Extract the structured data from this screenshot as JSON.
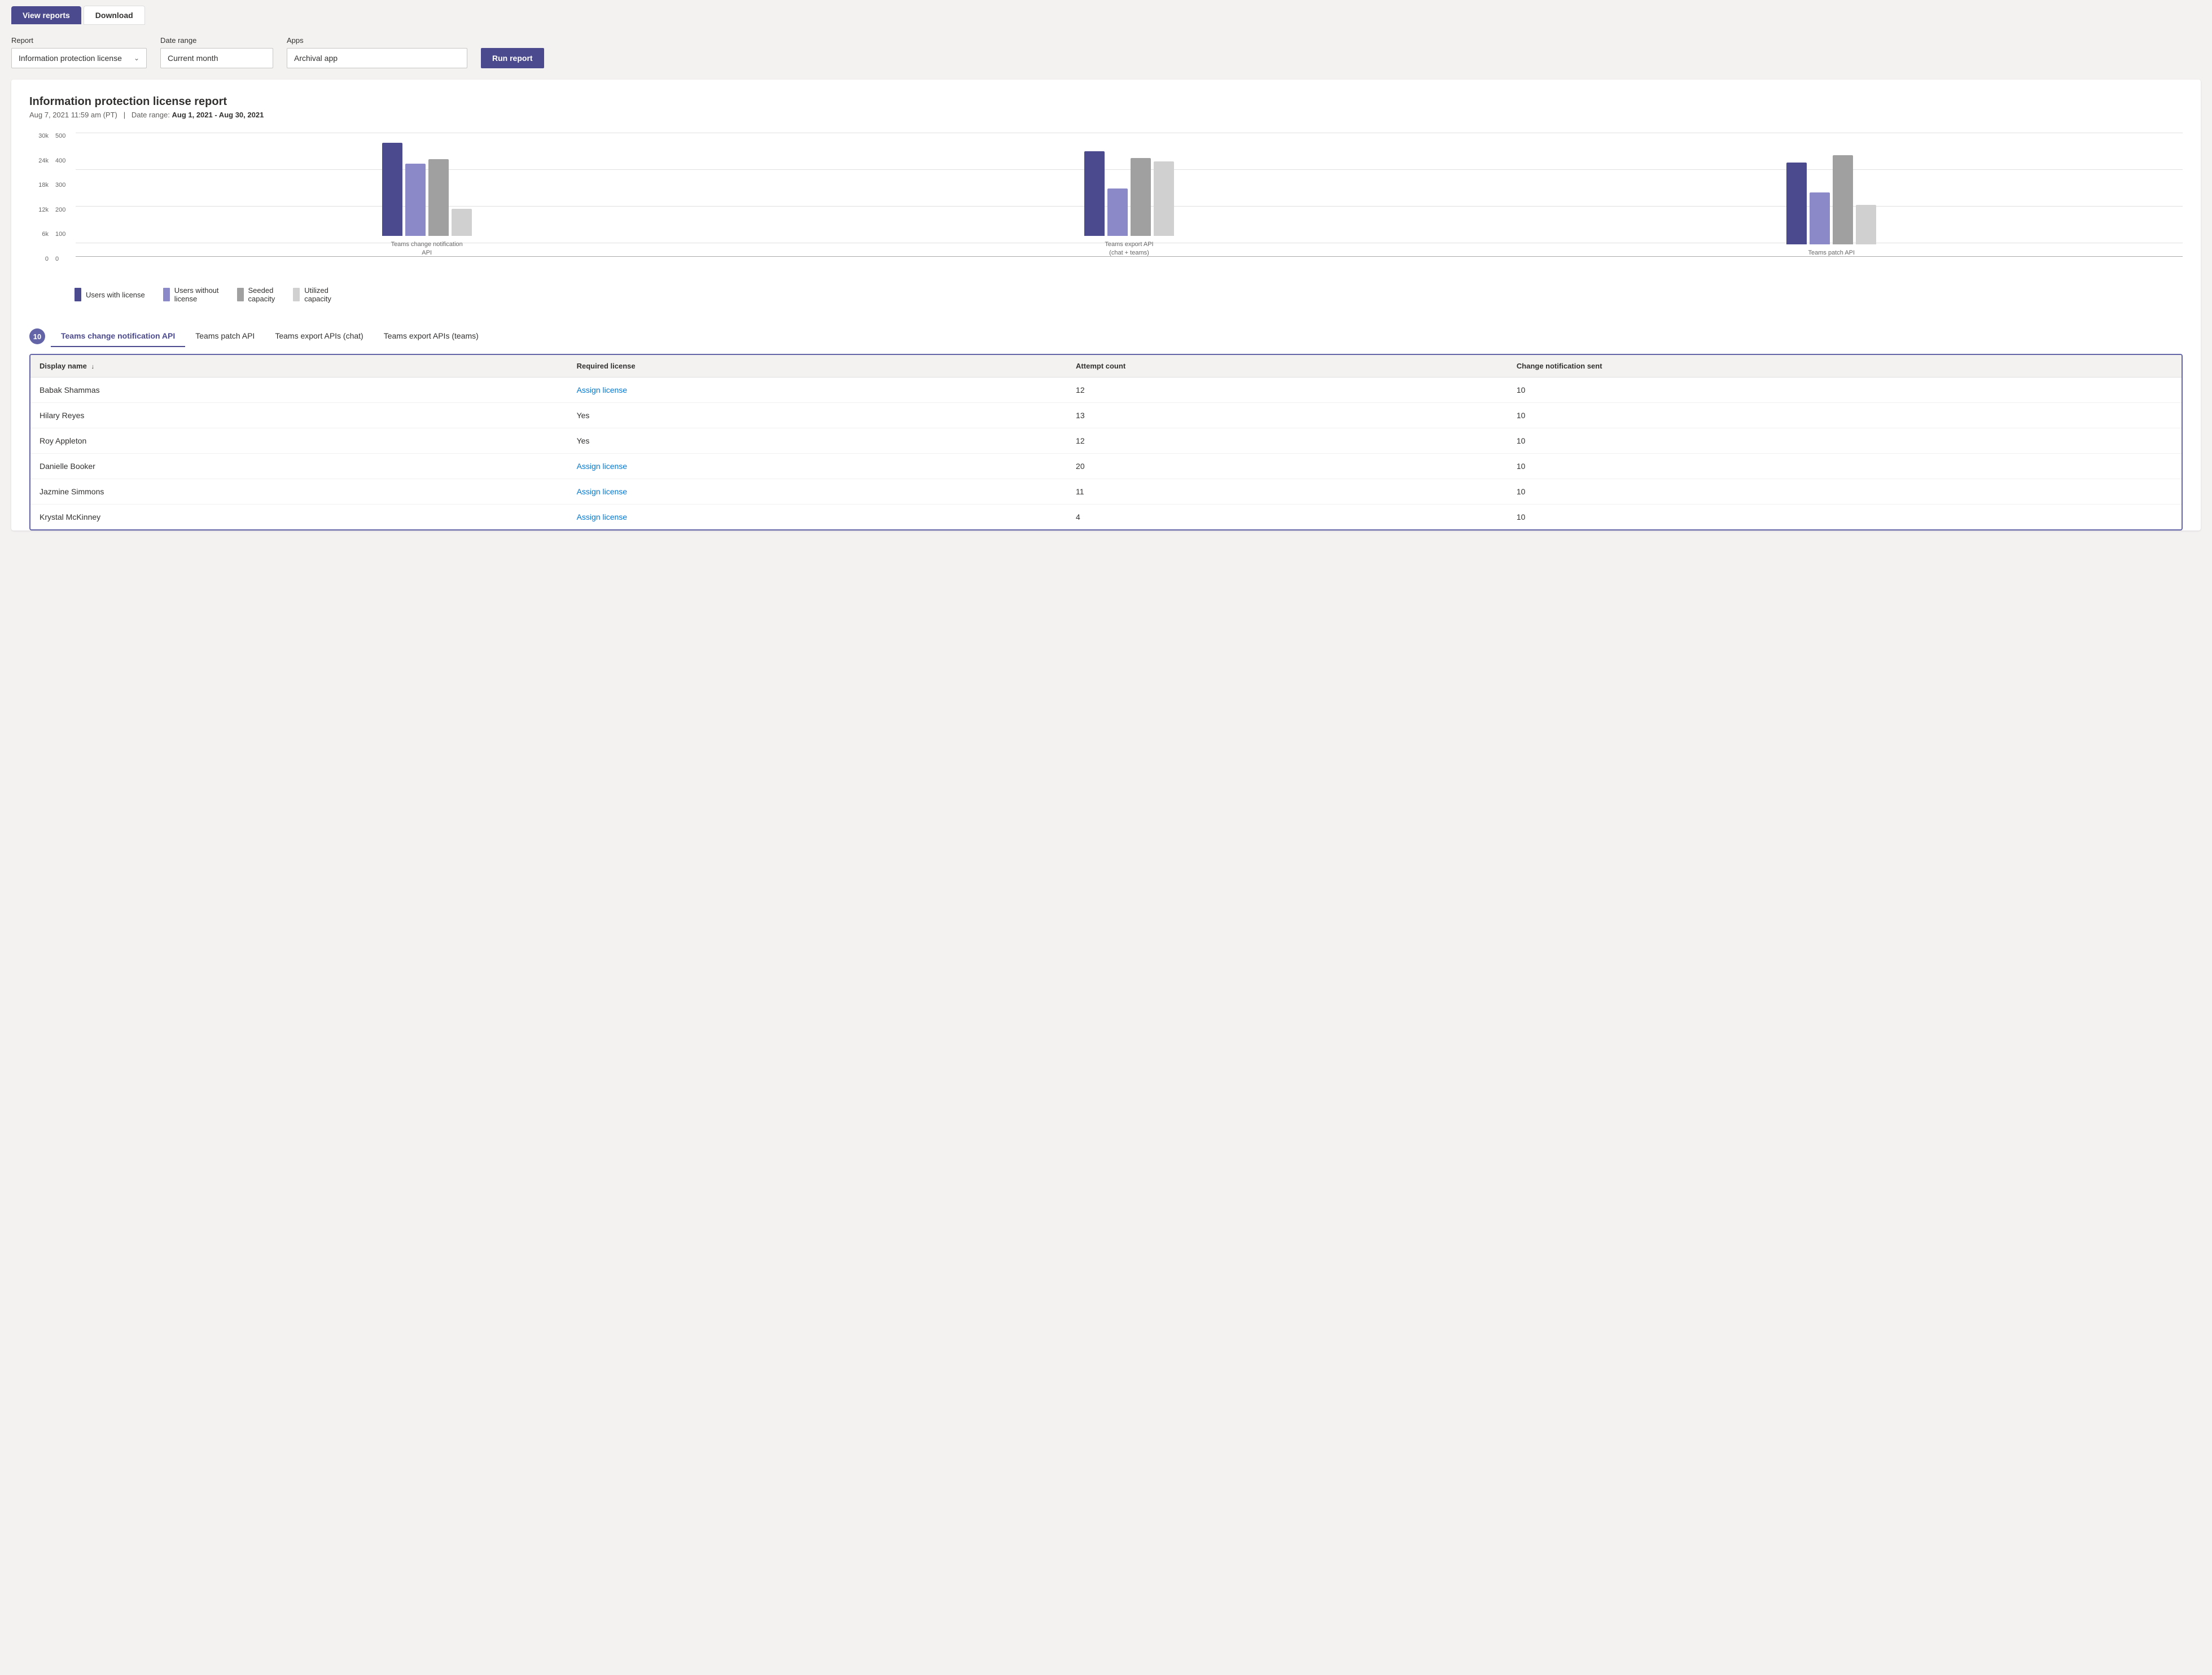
{
  "tabs": [
    {
      "id": "view-reports",
      "label": "View reports",
      "active": true
    },
    {
      "id": "download",
      "label": "Download",
      "active": false
    }
  ],
  "filters": {
    "report_label": "Report",
    "report_value": "Information protection license",
    "date_range_label": "Date range",
    "date_range_value": "Current month",
    "apps_label": "Apps",
    "apps_value": "Archival app",
    "run_report_label": "Run report"
  },
  "report": {
    "title": "Information protection license report",
    "timestamp": "Aug 7, 2021 11:59 am (PT)",
    "date_range_prefix": "Date range:",
    "date_range_value": "Aug 1, 2021 - Aug 30, 2021",
    "chart": {
      "y_axis_left": [
        "30k",
        "24k",
        "18k",
        "12k",
        "6k",
        "0"
      ],
      "y_axis_right": [
        "500",
        "400",
        "300",
        "200",
        "100",
        "0"
      ],
      "groups": [
        {
          "label": "Teams change notification API",
          "bars": [
            {
              "color": "dark-blue",
              "height_pct": 75
            },
            {
              "color": "medium-blue",
              "height_pct": 58
            },
            {
              "color": "medium-gray",
              "height_pct": 62
            },
            {
              "color": "light-gray",
              "height_pct": 22
            }
          ]
        },
        {
          "label": "Teams export API\n(chat + teams)",
          "bars": [
            {
              "color": "dark-blue",
              "height_pct": 68
            },
            {
              "color": "medium-blue",
              "height_pct": 38
            },
            {
              "color": "medium-gray",
              "height_pct": 63
            },
            {
              "color": "light-gray",
              "height_pct": 60
            }
          ]
        },
        {
          "label": "Teams patch API",
          "bars": [
            {
              "color": "dark-blue",
              "height_pct": 66
            },
            {
              "color": "medium-blue",
              "height_pct": 42
            },
            {
              "color": "medium-gray",
              "height_pct": 72
            },
            {
              "color": "light-gray",
              "height_pct": 32
            }
          ]
        }
      ],
      "legend": [
        {
          "color": "dark-blue",
          "label": "Users with\nlicense"
        },
        {
          "color": "medium-blue",
          "label": "Users without\nlicense"
        },
        {
          "color": "medium-gray",
          "label": "Seeded\ncapacity"
        },
        {
          "color": "light-gray",
          "label": "Utilized\ncapacity"
        }
      ]
    },
    "data_tabs": [
      {
        "id": "teams-change-notification-api",
        "label": "Teams change notification API",
        "active": true
      },
      {
        "id": "teams-patch-api",
        "label": "Teams patch API",
        "active": false
      },
      {
        "id": "teams-export-apis-chat",
        "label": "Teams export APIs (chat)",
        "active": false
      },
      {
        "id": "teams-export-apis-teams",
        "label": "Teams export APIs (teams)",
        "active": false
      }
    ],
    "badge_count": "10",
    "table": {
      "columns": [
        {
          "id": "display-name",
          "label": "Display name",
          "sortable": true,
          "sort_dir": "asc"
        },
        {
          "id": "required-license",
          "label": "Required license",
          "sortable": false
        },
        {
          "id": "attempt-count",
          "label": "Attempt count",
          "sortable": false
        },
        {
          "id": "change-notification-sent",
          "label": "Change notification sent",
          "sortable": false
        }
      ],
      "rows": [
        {
          "display_name": "Babak Shammas",
          "required_license": "Assign license",
          "required_license_type": "link",
          "attempt_count": "12",
          "change_notification_sent": "10"
        },
        {
          "display_name": "Hilary Reyes",
          "required_license": "Yes",
          "required_license_type": "text",
          "attempt_count": "13",
          "change_notification_sent": "10"
        },
        {
          "display_name": "Roy Appleton",
          "required_license": "Yes",
          "required_license_type": "text",
          "attempt_count": "12",
          "change_notification_sent": "10"
        },
        {
          "display_name": "Danielle Booker",
          "required_license": "Assign license",
          "required_license_type": "link",
          "attempt_count": "20",
          "change_notification_sent": "10"
        },
        {
          "display_name": "Jazmine Simmons",
          "required_license": "Assign license",
          "required_license_type": "link",
          "attempt_count": "11",
          "change_notification_sent": "10"
        },
        {
          "display_name": "Krystal McKinney",
          "required_license": "Assign license",
          "required_license_type": "link",
          "attempt_count": "4",
          "change_notification_sent": "10"
        }
      ]
    }
  }
}
